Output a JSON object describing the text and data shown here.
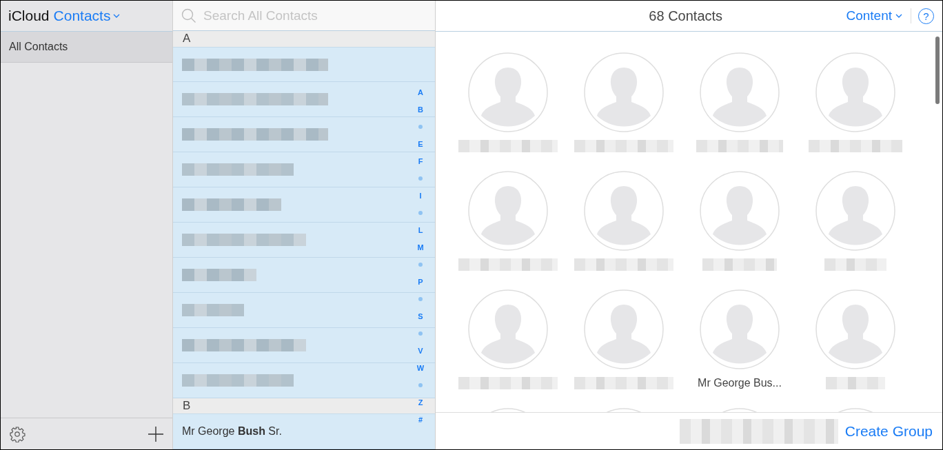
{
  "brand": {
    "app": "iCloud",
    "section": "Contacts"
  },
  "sidebar": {
    "items": [
      {
        "label": "All Contacts",
        "selected": true
      }
    ]
  },
  "search": {
    "placeholder": "Search All Contacts"
  },
  "list": {
    "sections": [
      {
        "letter": "A",
        "rows": [
          {
            "kind": "blurred",
            "selected": true
          },
          {
            "kind": "blurred",
            "selected": true
          },
          {
            "kind": "blurred",
            "selected": true
          },
          {
            "kind": "blurred",
            "selected": true
          },
          {
            "kind": "blurred",
            "selected": true
          },
          {
            "kind": "blurred",
            "selected": true
          },
          {
            "kind": "blurred",
            "selected": true
          },
          {
            "kind": "blurred",
            "selected": true
          },
          {
            "kind": "blurred",
            "selected": true
          },
          {
            "kind": "blurred",
            "selected": true
          }
        ]
      },
      {
        "letter": "B",
        "rows": [
          {
            "kind": "name",
            "name": "Mr George **Bush** Sr.",
            "selected": true
          }
        ]
      }
    ]
  },
  "index": [
    {
      "kind": "letter",
      "label": "A"
    },
    {
      "kind": "letter",
      "label": "B"
    },
    {
      "kind": "dot"
    },
    {
      "kind": "letter",
      "label": "E"
    },
    {
      "kind": "letter",
      "label": "F"
    },
    {
      "kind": "dot"
    },
    {
      "kind": "letter",
      "label": "I"
    },
    {
      "kind": "dot"
    },
    {
      "kind": "letter",
      "label": "L"
    },
    {
      "kind": "letter",
      "label": "M"
    },
    {
      "kind": "dot"
    },
    {
      "kind": "letter",
      "label": "P"
    },
    {
      "kind": "dot"
    },
    {
      "kind": "letter",
      "label": "S"
    },
    {
      "kind": "dot"
    },
    {
      "kind": "letter",
      "label": "V"
    },
    {
      "kind": "letter",
      "label": "W"
    },
    {
      "kind": "dot"
    },
    {
      "kind": "letter",
      "label": "Z"
    },
    {
      "kind": "letter",
      "label": "#"
    }
  ],
  "header": {
    "title": "68 Contacts",
    "menu": "Content",
    "help": "?"
  },
  "cards": [
    {
      "kind": "blurred"
    },
    {
      "kind": "blurred"
    },
    {
      "kind": "blurred"
    },
    {
      "kind": "blurred"
    },
    {
      "kind": "blurred"
    },
    {
      "kind": "blurred"
    },
    {
      "kind": "blurred"
    },
    {
      "kind": "blurred"
    },
    {
      "kind": "blurred"
    },
    {
      "kind": "blurred"
    },
    {
      "kind": "name",
      "name": "Mr George Bus..."
    },
    {
      "kind": "blurred"
    },
    {
      "kind": "cut"
    },
    {
      "kind": "cut"
    },
    {
      "kind": "cut"
    },
    {
      "kind": "cut"
    }
  ],
  "footer": {
    "action": "Create Group"
  }
}
